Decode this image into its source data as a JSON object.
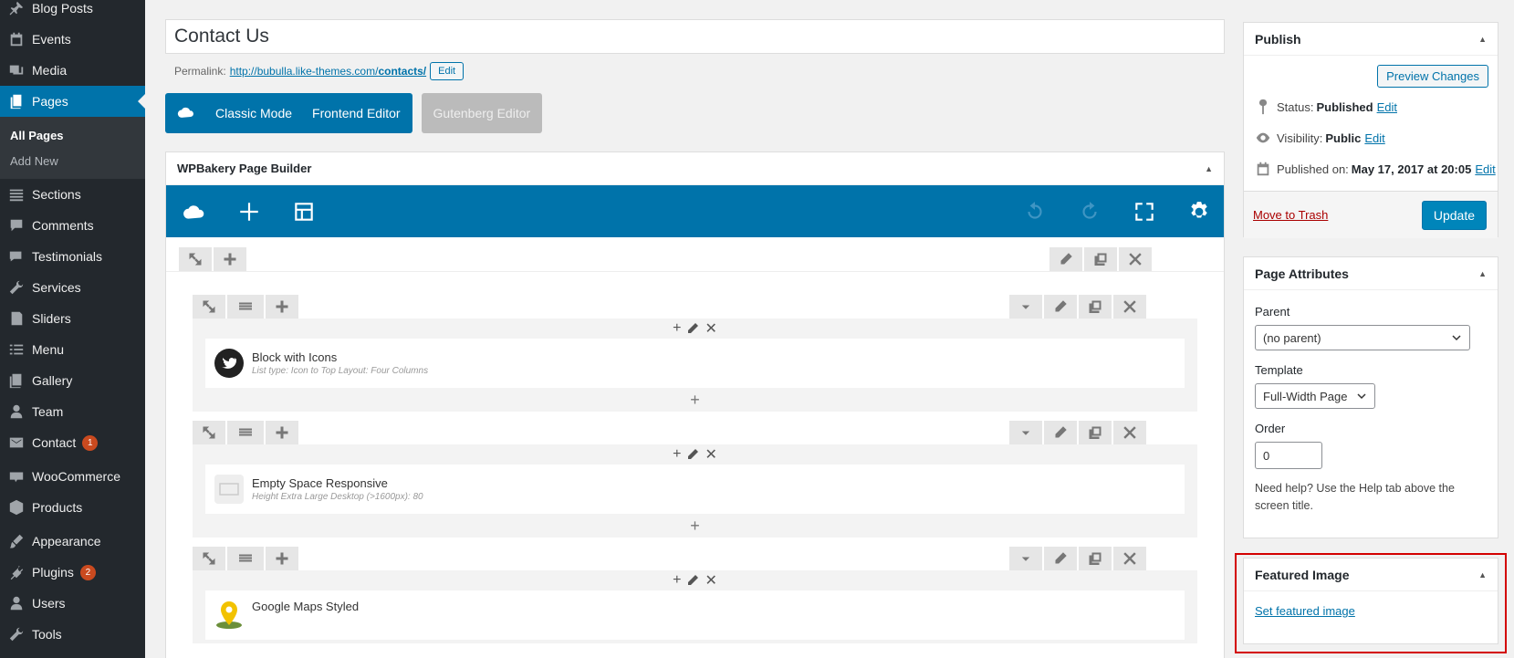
{
  "sidebar": {
    "items": [
      {
        "label": "Blog Posts",
        "icon": "pin-icon"
      },
      {
        "label": "Events",
        "icon": "calendar-icon"
      },
      {
        "label": "Media",
        "icon": "media-icon"
      },
      {
        "label": "Pages",
        "icon": "pages-icon",
        "active": true
      },
      {
        "label": "Sections",
        "icon": "sections-icon"
      },
      {
        "label": "Comments",
        "icon": "comment-icon"
      },
      {
        "label": "Testimonials",
        "icon": "testimonials-icon"
      },
      {
        "label": "Services",
        "icon": "wrench-icon"
      },
      {
        "label": "Sliders",
        "icon": "sliders-icon"
      },
      {
        "label": "Menu",
        "icon": "menu-icon"
      },
      {
        "label": "Gallery",
        "icon": "gallery-icon"
      },
      {
        "label": "Team",
        "icon": "user-icon"
      },
      {
        "label": "Contact",
        "icon": "mail-icon",
        "badge": "1"
      },
      {
        "label": "WooCommerce",
        "icon": "woo-icon"
      },
      {
        "label": "Products",
        "icon": "products-icon"
      },
      {
        "label": "Appearance",
        "icon": "brush-icon"
      },
      {
        "label": "Plugins",
        "icon": "plugin-icon",
        "badge": "2"
      },
      {
        "label": "Users",
        "icon": "users-icon"
      },
      {
        "label": "Tools",
        "icon": "tools-icon"
      }
    ],
    "submenu": [
      "All Pages",
      "Add New"
    ]
  },
  "editor": {
    "title_value": "Contact Us",
    "permalink_label": "Permalink:",
    "permalink_base": "http://bubulla.like-themes.com/",
    "permalink_slug": "contacts/",
    "permalink_edit": "Edit",
    "modes": {
      "classic": "Classic Mode",
      "frontend": "Frontend Editor",
      "gutenberg": "Gutenberg Editor"
    }
  },
  "wpbakery": {
    "title": "WPBakery Page Builder",
    "elements": [
      {
        "title": "Block with Icons",
        "sub": "List type: Icon to Top  Layout: Four Columns",
        "icon": "twitter-icon"
      },
      {
        "title": "Empty Space Responsive",
        "sub": "Height Extra Large Desktop (>1600px): 80",
        "icon": "empty-space-icon"
      },
      {
        "title": "Google Maps Styled",
        "sub": "",
        "icon": "map-pin-icon"
      }
    ]
  },
  "publish": {
    "title": "Publish",
    "preview": "Preview Changes",
    "status_label": "Status:",
    "status_value": "Published",
    "visibility_label": "Visibility:",
    "visibility_value": "Public",
    "published_label": "Published on:",
    "published_value": "May 17, 2017 at 20:05",
    "edit": "Edit",
    "trash": "Move to Trash",
    "update": "Update"
  },
  "page_attributes": {
    "title": "Page Attributes",
    "parent_label": "Parent",
    "parent_value": "(no parent)",
    "template_label": "Template",
    "template_value": "Full-Width Page",
    "order_label": "Order",
    "order_value": "0",
    "help": "Need help? Use the Help tab above the screen title."
  },
  "featured": {
    "title": "Featured Image",
    "link": "Set featured image"
  },
  "colors": {
    "accent": "#0073aa",
    "sidebar": "#23282d",
    "highlight": "#d30000"
  }
}
